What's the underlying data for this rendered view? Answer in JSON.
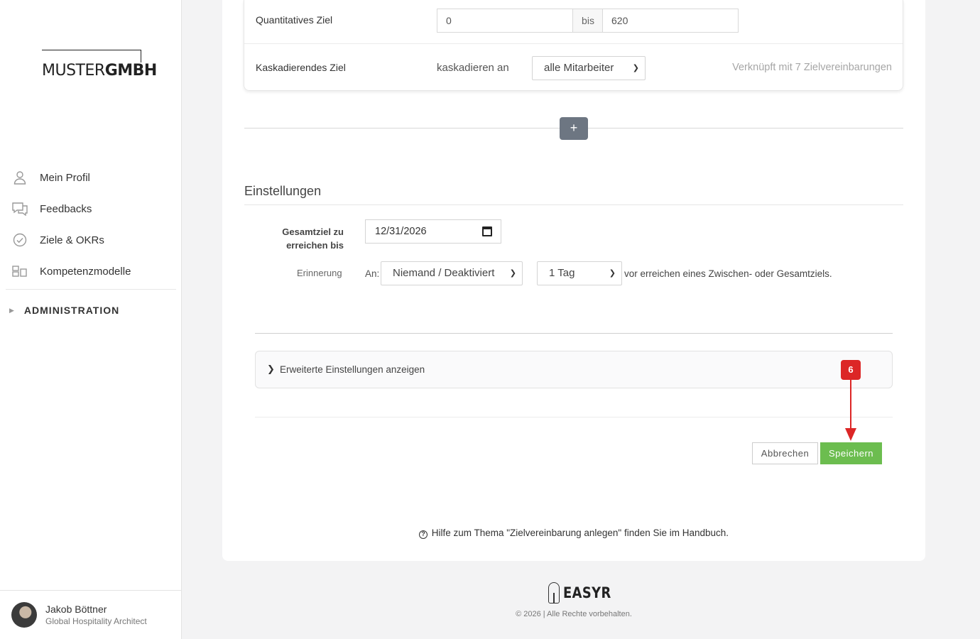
{
  "brand": {
    "logo_thin": "MUSTER",
    "logo_bold": "GMBH"
  },
  "sidebar": {
    "items": [
      {
        "label": "Mein Profil",
        "icon": "user-icon"
      },
      {
        "label": "Feedbacks",
        "icon": "chat-icon"
      },
      {
        "label": "Ziele & OKRs",
        "icon": "check-circle-icon"
      },
      {
        "label": "Kompetenzmodelle",
        "icon": "grid-icon"
      }
    ],
    "admin_label": "ADMINISTRATION"
  },
  "user": {
    "name": "Jakob Böttner",
    "role": "Global Hospitality Architect"
  },
  "goal": {
    "quant_label": "Quantitatives Ziel",
    "quant_from": "0",
    "quant_sep": "bis",
    "quant_to": "620",
    "cascade_label": "Kaskadierendes Ziel",
    "cascade_text": "kaskadieren an",
    "cascade_select": "alle Mitarbeiter",
    "linked_text": "Verknüpft mit 7 Zielvereinbarungen"
  },
  "add_button": "+",
  "settings": {
    "title": "Einstellungen",
    "date_label": "Gesamtziel zu erreichen bis",
    "date_value": "12/31/2026",
    "reminder_label": "Erinnerung",
    "to_label": "An:",
    "recipient_select": "Niemand / Deaktiviert",
    "interval_select": "1 Tag",
    "reminder_suffix": "vor erreichen eines Zwischen- oder Gesamtziels."
  },
  "advanced": {
    "label": "Erweiterte Einstellungen anzeigen"
  },
  "actions": {
    "cancel": "Abbrechen",
    "save": "Speichern"
  },
  "annotation": {
    "step": "6",
    "color": "#dc2626"
  },
  "help_text": "Hilfe zum Thema \"Zielvereinbarung anlegen\" finden Sie im Handbuch.",
  "footer": {
    "brand": "EASYR",
    "copyright": "© 2026 | Alle Rechte vorbehalten."
  },
  "colors": {
    "save": "#6cbd4f",
    "add": "#6d7682"
  }
}
